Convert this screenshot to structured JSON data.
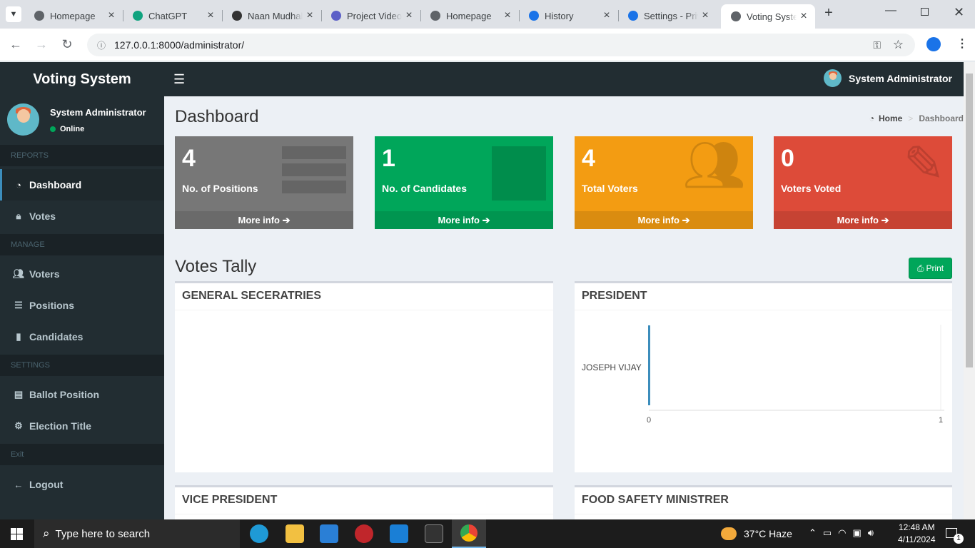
{
  "browser": {
    "tabs": [
      {
        "title": "Homepage",
        "icon": "globe-icon",
        "color": "#5f6368"
      },
      {
        "title": "ChatGPT",
        "icon": "chatgpt-icon",
        "color": "#10a37f"
      },
      {
        "title": "Naan Mudhalvan",
        "icon": "naan-mudhalvan-icon",
        "color": "#333333"
      },
      {
        "title": "Project Video",
        "icon": "project-video-icon",
        "color": "#5b5fc7"
      },
      {
        "title": "Homepage",
        "icon": "globe-icon",
        "color": "#5f6368"
      },
      {
        "title": "History",
        "icon": "history-icon",
        "color": "#1a73e8"
      },
      {
        "title": "Settings - Privacy",
        "icon": "settings-icon",
        "color": "#1a73e8"
      },
      {
        "title": "Voting System",
        "icon": "globe-icon",
        "color": "#5f6368",
        "active": true
      }
    ],
    "url": "127.0.0.1:8000/administrator/"
  },
  "app": {
    "logo": "Voting System",
    "admin_name": "System Administrator",
    "status": "Online"
  },
  "sidebar": {
    "sections": {
      "reports": "REPORTS",
      "manage": "MANAGE",
      "settings": "SETTINGS",
      "exit": "Exit"
    },
    "items": {
      "dashboard": "Dashboard",
      "votes": "Votes",
      "voters": "Voters",
      "positions": "Positions",
      "candidates": "Candidates",
      "ballot": "Ballot Position",
      "election": "Election Title",
      "logout": "Logout"
    }
  },
  "main": {
    "title": "Dashboard",
    "breadcrumb": {
      "home": "Home",
      "sep": ">",
      "current": "Dashboard"
    },
    "stats": [
      {
        "value": "4",
        "label": "No. of Positions",
        "more": "More info",
        "color": "#777777"
      },
      {
        "value": "1",
        "label": "No. of Candidates",
        "more": "More info",
        "color": "#00a65a"
      },
      {
        "value": "4",
        "label": "Total Voters",
        "more": "More info",
        "color": "#f39c12"
      },
      {
        "value": "0",
        "label": "Voters Voted",
        "more": "More info",
        "color": "#dd4b39"
      }
    ],
    "tally_title": "Votes Tally",
    "print_label": "Print",
    "panels": {
      "p1": "GENERAL SECERATRIES",
      "p2": "PRESIDENT",
      "p3": "VICE PRESIDENT",
      "p4": "FOOD SAFETY MINISTRER"
    }
  },
  "chart_data": {
    "type": "bar",
    "orientation": "horizontal",
    "categories": [
      "JOSEPH VIJAY"
    ],
    "values": [
      0
    ],
    "xlim": [
      0,
      1
    ],
    "x_ticks": [
      "0",
      "1"
    ],
    "color": "#3c8dbc"
  },
  "taskbar": {
    "search_placeholder": "Type here to search",
    "weather": "37°C  Haze",
    "time": "12:48 AM",
    "date": "4/11/2024",
    "notif_count": "1"
  }
}
